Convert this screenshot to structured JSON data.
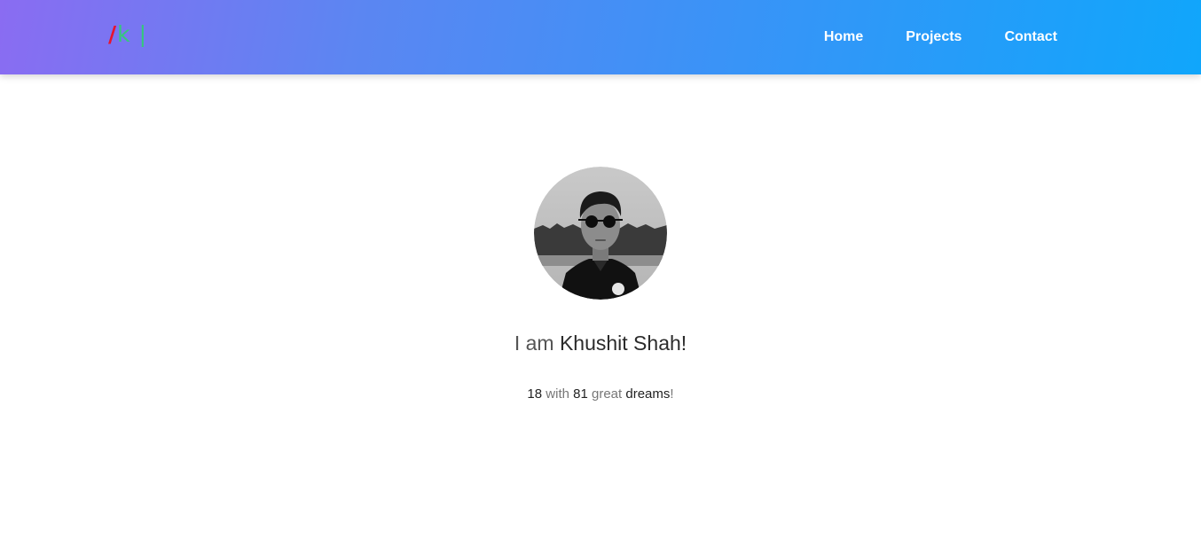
{
  "logo": {
    "slash": "/",
    "letter": "k",
    "cursor": "|"
  },
  "nav": {
    "items": [
      {
        "label": "Home"
      },
      {
        "label": "Projects"
      },
      {
        "label": "Contact"
      }
    ]
  },
  "hero": {
    "intro": "I am",
    "name": "Khushit Shah!",
    "tagline": {
      "age": "18",
      "with": "with",
      "count": "81",
      "great": "great",
      "dreams": "dreams",
      "end": "!"
    }
  },
  "colors": {
    "gradient_start": "#8a6cf2",
    "gradient_end": "#10a6fb",
    "logo_slash": "#e8132e",
    "logo_letter": "#35c87c"
  }
}
